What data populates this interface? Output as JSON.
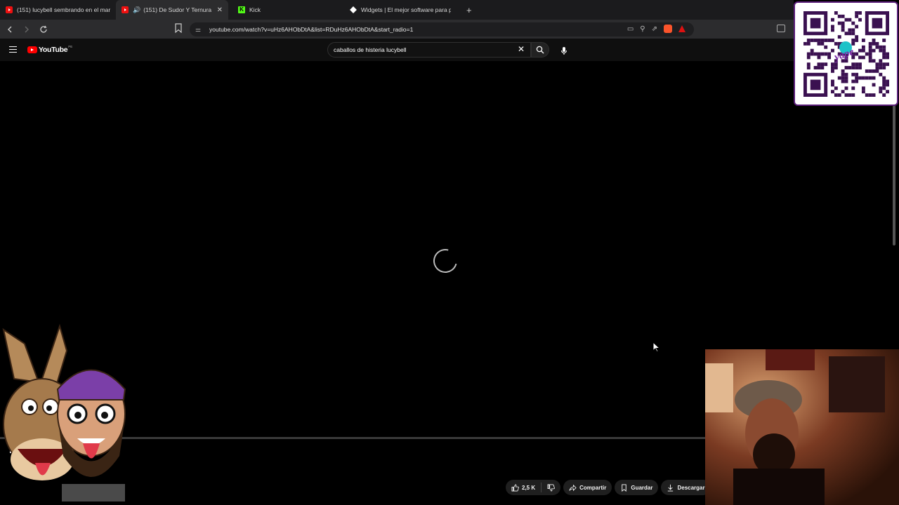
{
  "browser": {
    "tabs": [
      {
        "title": "(151) lucybell sembrando en el mar",
        "favicon": "youtube-icon"
      },
      {
        "title": "(151) De Sudor Y Ternura - Yo",
        "favicon": "youtube-icon",
        "audio": "speaker-icon",
        "active": true
      },
      {
        "title": "Kick",
        "favicon": "kick-icon"
      },
      {
        "title": "Widgets | El mejor software para pot",
        "favicon": "widget-icon"
      }
    ],
    "url": "youtube.com/watch?v=uHz6AHObDtA&list=RDuHz6AHObDtA&start_radio=1"
  },
  "youtube": {
    "logo_text": "YouTube",
    "country_code": "PE",
    "search_query": "caballos de histeria lucybell",
    "actions": {
      "like_count": "2,5 K",
      "share": "Compartir",
      "save": "Guardar",
      "download": "Descargar"
    },
    "player": {
      "state": "loading",
      "progress_percent": 0
    }
  },
  "overlays": {
    "qr_brand": "yape",
    "qr_badge": "S/"
  },
  "colors": {
    "brand": "#ff0000",
    "qr_border": "#5b1e7a",
    "yape_purple": "#7b2aa8"
  }
}
